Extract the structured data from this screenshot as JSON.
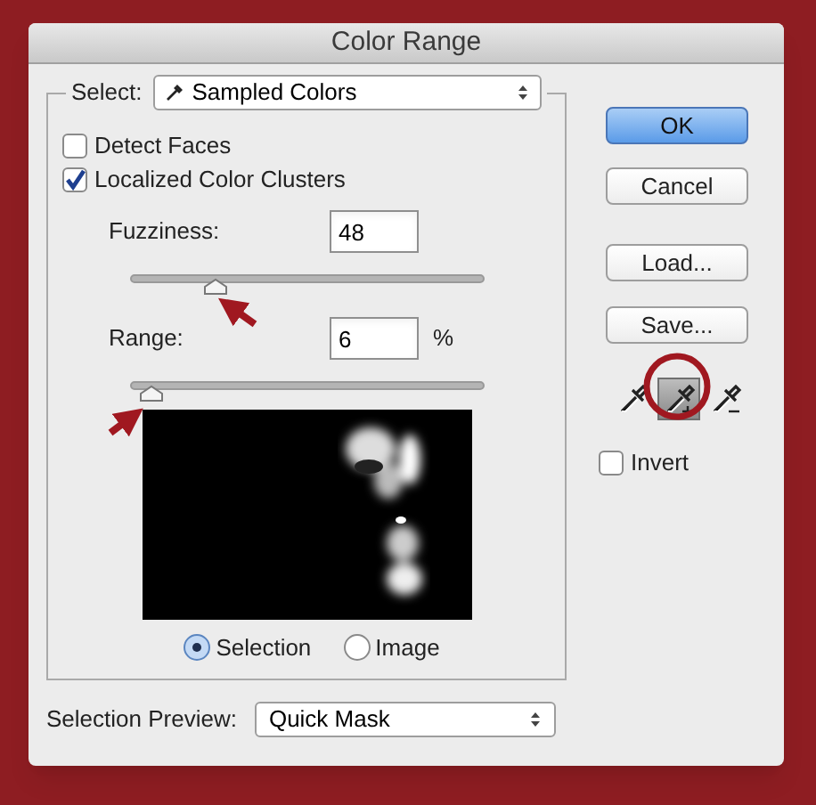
{
  "window": {
    "title": "Color Range"
  },
  "select": {
    "label": "Select:",
    "value": "Sampled Colors"
  },
  "checkboxes": [
    {
      "label": "Detect Faces",
      "checked": false
    },
    {
      "label": "Localized Color Clusters",
      "checked": true
    }
  ],
  "sliders": [
    {
      "label": "Fuzziness:",
      "value": "48",
      "level": 0.24
    },
    {
      "label": "Range:",
      "value": "6",
      "unit": "%",
      "level": 0.055
    }
  ],
  "preview_modes": [
    {
      "label": "Selection",
      "selected": true
    },
    {
      "label": "Image",
      "selected": false
    }
  ],
  "selection_preview": {
    "label": "Selection Preview:",
    "value": "Quick Mask"
  },
  "buttons": [
    {
      "label": "OK",
      "default": true
    },
    {
      "label": "Cancel",
      "default": false
    },
    {
      "label": "Load...",
      "default": false
    },
    {
      "label": "Save...",
      "default": false
    }
  ],
  "eyedroppers": [
    {
      "kind": "sample",
      "selected": false
    },
    {
      "kind": "add",
      "selected": true
    },
    {
      "kind": "subtract",
      "selected": false
    }
  ],
  "invert": {
    "label": "Invert",
    "checked": false
  }
}
